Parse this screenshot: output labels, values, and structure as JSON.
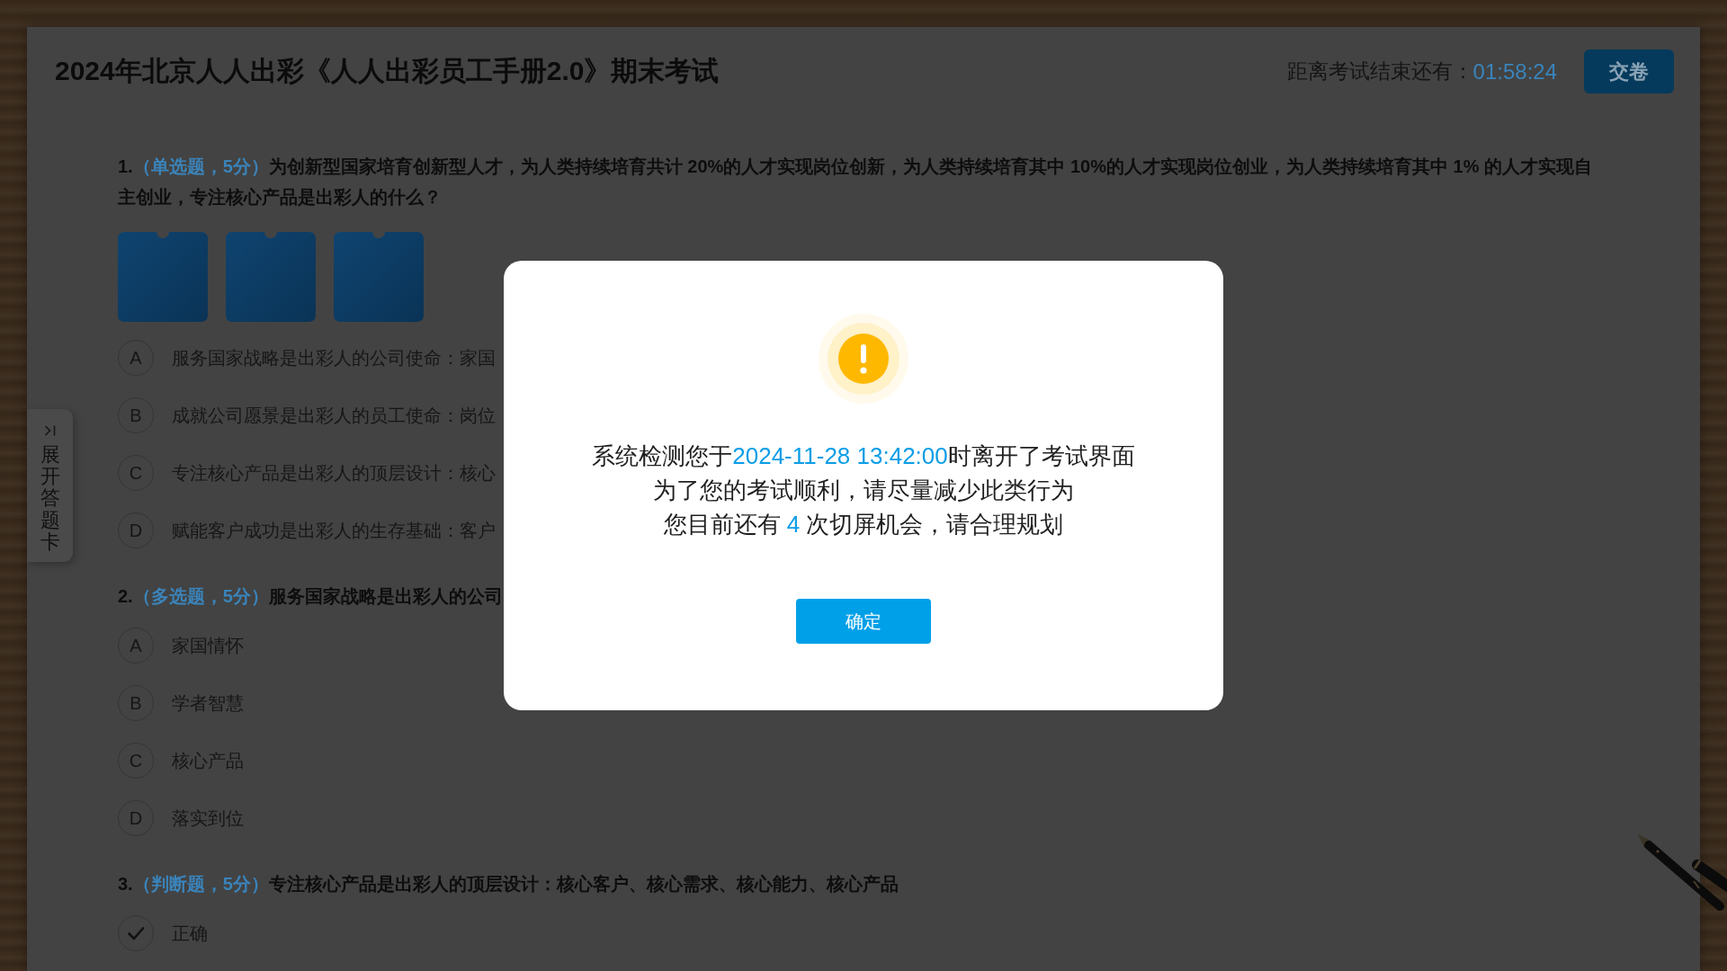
{
  "exam": {
    "title": "2024年北京人人出彩《人人出彩员工手册2.0》期末考试",
    "timer_label": "距离考试结束还有：",
    "timer_value": "01:58:24",
    "submit_button": "交卷"
  },
  "side_tab": {
    "label": "展开答题卡"
  },
  "questions": [
    {
      "number": "1.",
      "type": "（单选题，5分）",
      "stem": "为创新型国家培育创新型人才，为人类持续培育共计 20%的人才实现岗位创新，为人类持续培育其中 10%的人才实现岗位创业，为人类持续培育其中 1% 的人才实现自主创业，专注核心产品是出彩人的什么？",
      "images": [
        {
          "kind": "photo"
        },
        {
          "kind": "photo"
        },
        {
          "kind": "photo"
        }
      ],
      "options": [
        {
          "kind": "letter",
          "letter": "A",
          "text": "服务国家战略是出彩人的公司使命：家国",
          "selected": false
        },
        {
          "kind": "letter",
          "letter": "B",
          "text": "成就公司愿景是出彩人的员工使命：岗位",
          "selected": false
        },
        {
          "kind": "letter",
          "letter": "C",
          "text": "专注核心产品是出彩人的顶层设计：核心",
          "selected": false
        },
        {
          "kind": "letter",
          "letter": "D",
          "text": "赋能客户成功是出彩人的生存基础：客户",
          "selected": false
        }
      ]
    },
    {
      "number": "2.",
      "type": "（多选题，5分）",
      "stem": "服务国家战略是出彩人的公司",
      "options": [
        {
          "kind": "letter",
          "letter": "A",
          "text": "家国情怀",
          "selected": false
        },
        {
          "kind": "letter",
          "letter": "B",
          "text": "学者智慧",
          "selected": false
        },
        {
          "kind": "letter",
          "letter": "C",
          "text": "核心产品",
          "selected": false
        },
        {
          "kind": "letter",
          "letter": "D",
          "text": "落实到位",
          "selected": false
        }
      ]
    },
    {
      "number": "3.",
      "type": "（判断题，5分）",
      "stem": "专注核心产品是出彩人的顶层设计：核心客户、核心需求、核心能力、核心产品",
      "options": [
        {
          "kind": "tick",
          "text": "正确",
          "selected": false
        }
      ]
    }
  ],
  "dialog": {
    "lines": [
      {
        "parts": [
          {
            "text": "系统检测您于",
            "highlight": false
          },
          {
            "text": "2024-11-28 13:42:00",
            "highlight": true
          },
          {
            "text": "时离开了考试界面",
            "highlight": false
          }
        ]
      },
      {
        "parts": [
          {
            "text": "为了您的考试顺利，请尽量减少此类行为",
            "highlight": false
          }
        ]
      },
      {
        "parts": [
          {
            "text": "您目前还有 ",
            "highlight": false
          },
          {
            "text": "4",
            "highlight": true
          },
          {
            "text": " 次切屏机会，请合理规划",
            "highlight": false
          }
        ]
      }
    ],
    "confirm_button": "确定"
  }
}
